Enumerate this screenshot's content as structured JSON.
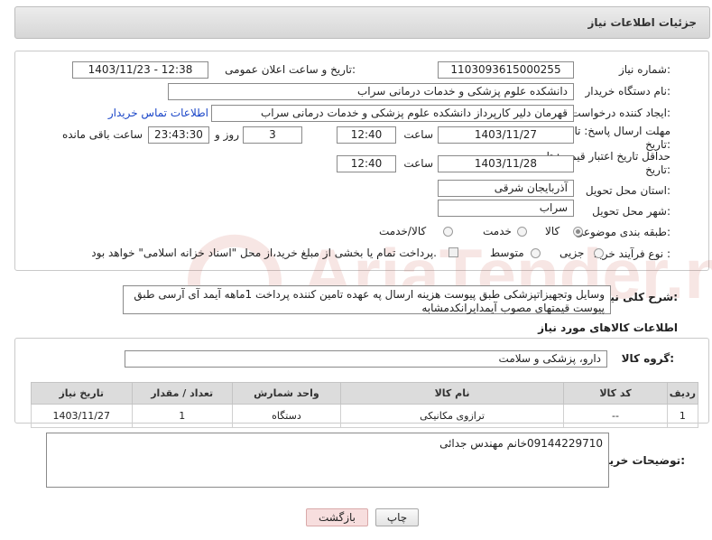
{
  "header": {
    "title": "جزئیات اطلاعات نیاز"
  },
  "form": {
    "need_number_label": "شماره نیاز:",
    "need_number": "1103093615000255",
    "announce_label": "تاریخ و ساعت اعلان عمومی:",
    "announce_value": "1403/11/23 - 12:38",
    "buyer_org_label": "نام دستگاه خریدار:",
    "buyer_org": "دانشکده علوم پزشکی و خدمات درمانی سراب",
    "requester_label": "ایجاد کننده درخواست:",
    "requester": "قهرمان دلیر کارپرداز دانشکده علوم پزشکی و خدمات درمانی سراب",
    "buyer_contact_link": "اطلاعات تماس خریدار",
    "reply_deadline_label": "مهلت ارسال پاسخ: تا تاریخ:",
    "reply_date": "1403/11/27",
    "time_label": "ساعت",
    "reply_time": "12:40",
    "days_value": "3",
    "days_label": "روز و",
    "remaining_time": "23:43:30",
    "remaining_label": "ساعت باقی مانده",
    "price_validity_label": "حداقل تاریخ اعتبار قیمت: تا تاریخ:",
    "validity_date": "1403/11/28",
    "validity_time": "12:40",
    "province_label": "استان محل تحویل:",
    "province": "آذربایجان شرقی",
    "city_label": "شهر محل تحویل:",
    "city": "سراب",
    "category_label": "طبقه بندی موضوعی:",
    "category_options": [
      "کالا",
      "خدمت",
      "کالا/خدمت"
    ],
    "process_label": "نوع فرآیند خرید :",
    "process_options": [
      "جزیی",
      "متوسط"
    ],
    "payment_note": "پرداخت تمام یا بخشی از مبلغ خرید،از محل \"اسناد خزانه اسلامی\" خواهد بود."
  },
  "description": {
    "label": "شرح کلی نیاز:",
    "text": "وسایل وتجهیزاتپزشکی طبق پیوست هزینه ارسال په عهده تامین کننده پرداخت 1ماهه آیمد آی آرسی طبق پیوست قیمتهای مصوب آیمدایرانکدمشابه"
  },
  "goods": {
    "section_title": "اطلاعات کالاهای مورد نیاز",
    "group_label": "گروه کالا:",
    "group_value": "دارو، پزشکی و سلامت",
    "table": {
      "headers": [
        "ردیف",
        "کد کالا",
        "نام کالا",
        "واحد شمارش",
        "تعداد / مقدار",
        "تاریخ نیاز"
      ],
      "rows": [
        [
          "1",
          "--",
          "ترازوی مکانیکی",
          "دستگاه",
          "1",
          "1403/11/27"
        ]
      ]
    }
  },
  "buyer_notes": {
    "label": "توضیحات خریدار:",
    "text": "09144229710خانم مهندس جدائی"
  },
  "buttons": {
    "print": "چاپ",
    "back": "بازگشت"
  },
  "watermark": {
    "text": "AriaTender.neT"
  },
  "colors": {
    "link": "#1a46c8",
    "back_button_bg": "#f7dede",
    "watermark": "#c0392b"
  }
}
